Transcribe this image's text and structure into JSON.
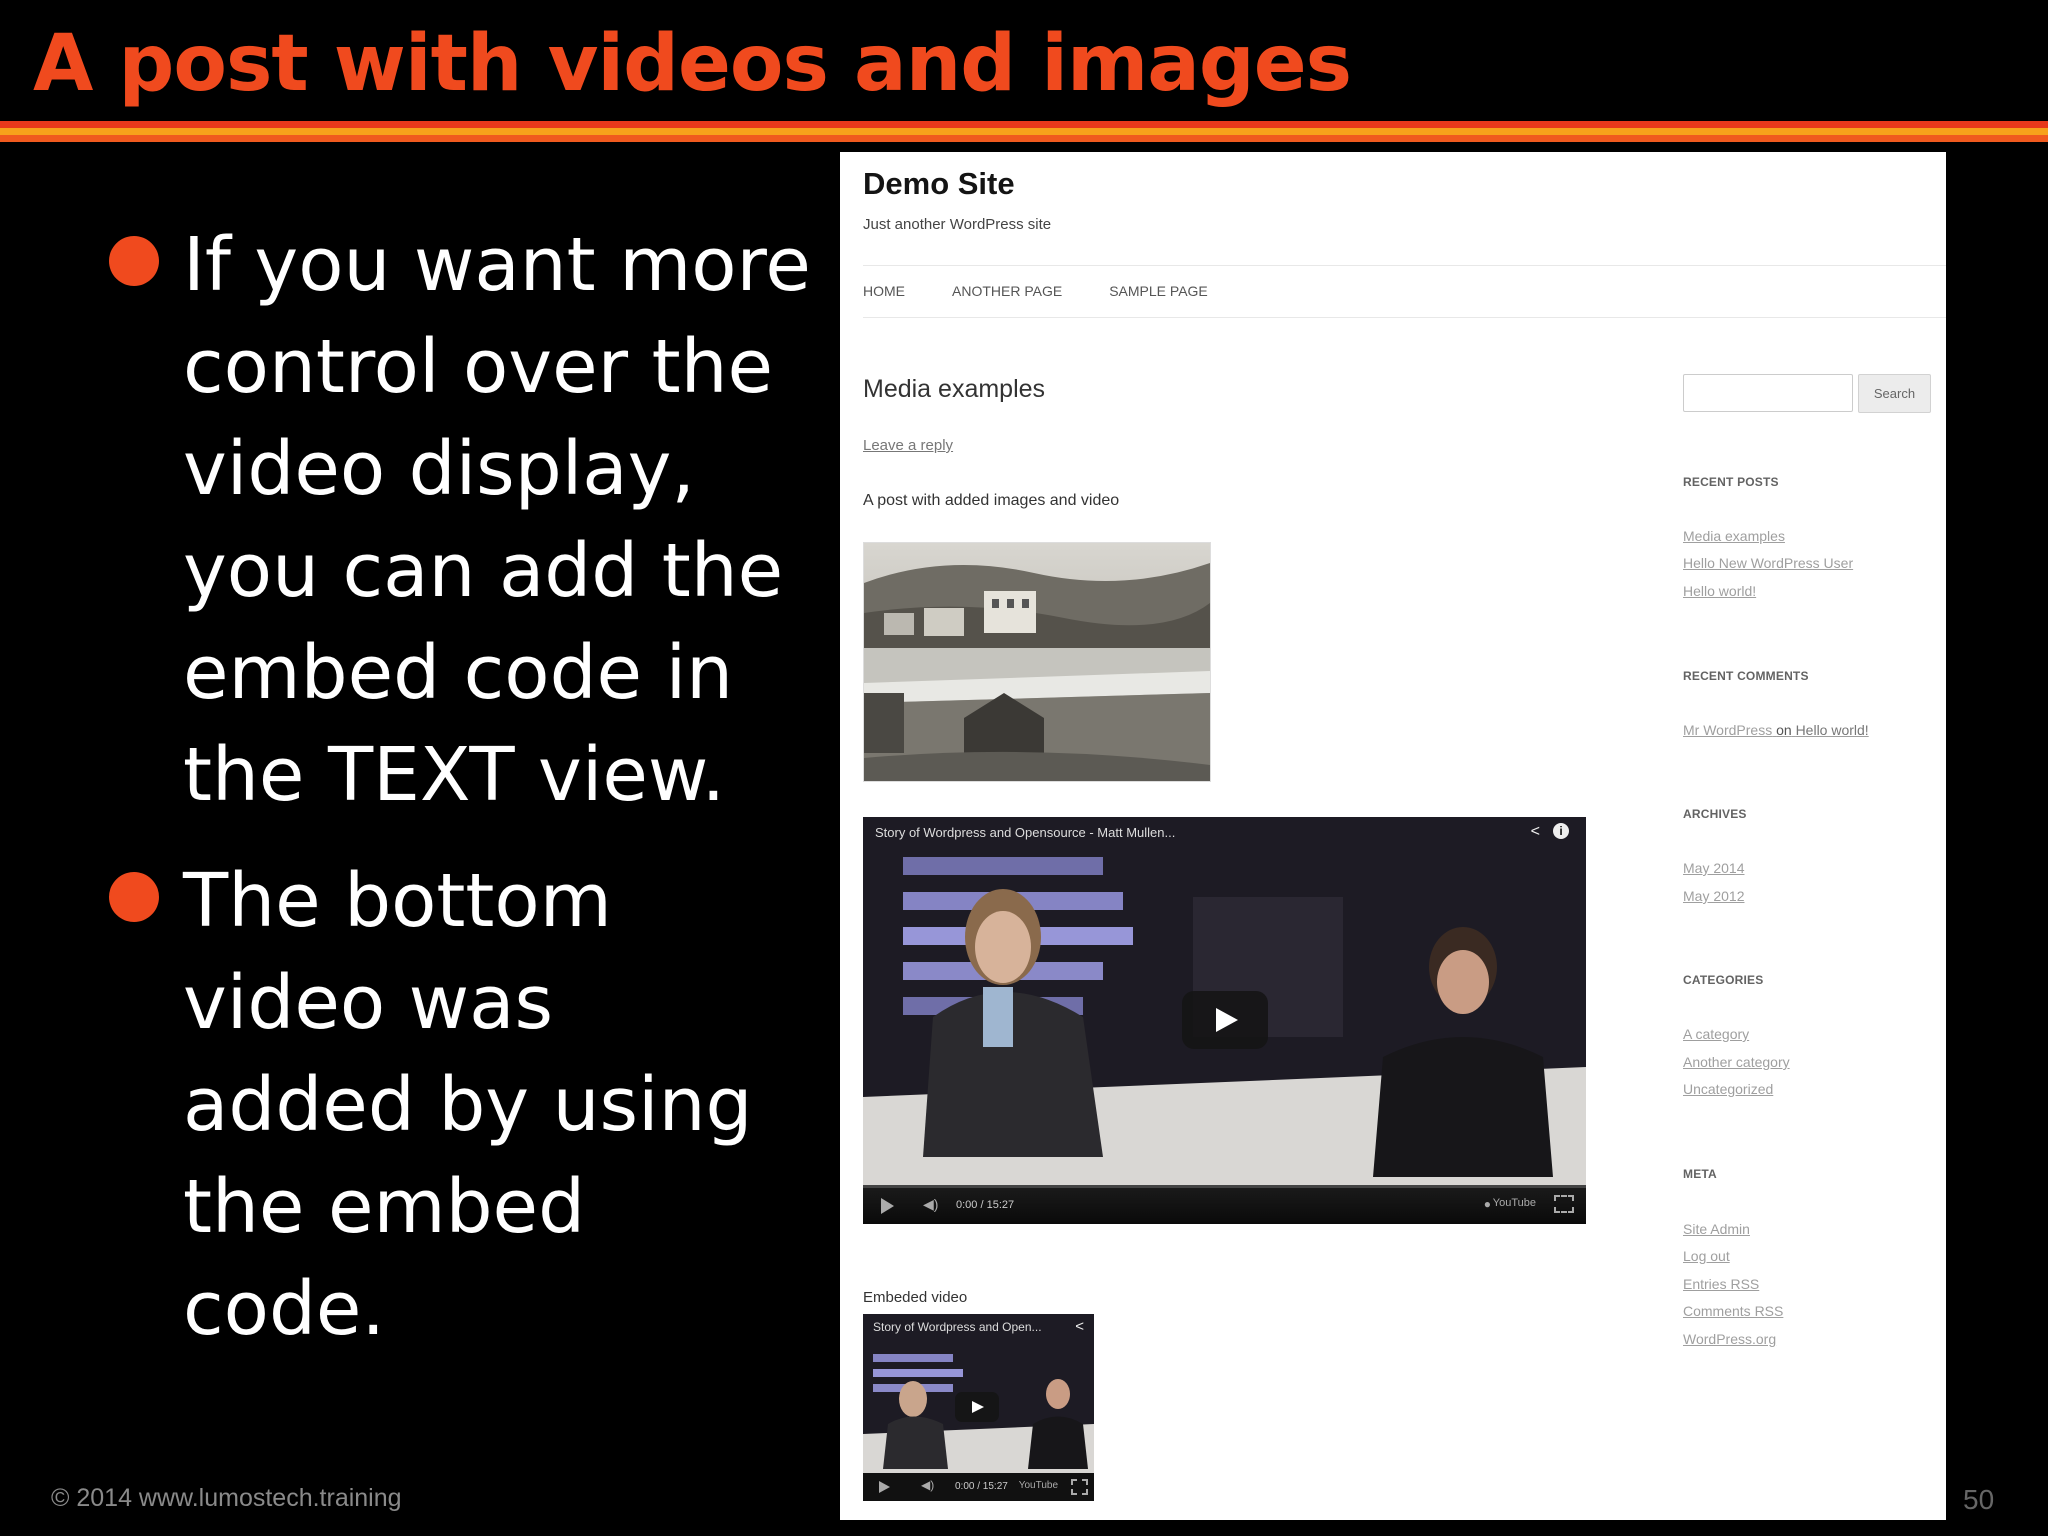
{
  "slide": {
    "title": "A post with videos and images",
    "bullets": [
      "If you want more control over the video display, you can add the embed code in the TEXT view.",
      "The bottom video was added by using the embed code."
    ],
    "footer": "© 2014  www.lumostech.training",
    "page_number": "50"
  },
  "site": {
    "title": "Demo Site",
    "description": "Just another WordPress site",
    "nav": [
      "HOME",
      "ANOTHER PAGE",
      "SAMPLE PAGE"
    ]
  },
  "post": {
    "title": "Media examples",
    "leave_reply": "Leave a reply",
    "text": "A post with added images and video",
    "video": {
      "title": "Story of Wordpress and Opensource - Matt Mullen...",
      "time": "0:00 / 15:27",
      "youtube": "YouTube"
    },
    "embed_label": "Embeded video",
    "embed_video": {
      "title": "Story of Wordpress and Open...",
      "time": "0:00 / 15:27",
      "youtube": "YouTube"
    }
  },
  "sidebar": {
    "search_button": "Search",
    "recent_posts": {
      "heading": "RECENT POSTS",
      "items": [
        "Media examples",
        "Hello New WordPress User",
        "Hello world!"
      ]
    },
    "recent_comments": {
      "heading": "RECENT COMMENTS",
      "author": "Mr WordPress",
      "on": "on",
      "post": "Hello world!"
    },
    "archives": {
      "heading": "ARCHIVES",
      "items": [
        "May 2014",
        "May 2012"
      ]
    },
    "categories": {
      "heading": "CATEGORIES",
      "items": [
        "A category",
        "Another category",
        "Uncategorized"
      ]
    },
    "meta": {
      "heading": "META",
      "items": [
        "Site Admin",
        "Log out",
        "Entries RSS",
        "Comments RSS",
        "WordPress.org"
      ]
    }
  },
  "colors": {
    "accent": "#f04a1e",
    "stripe_red": "#e8391b",
    "stripe_orange": "#f7a21b"
  }
}
